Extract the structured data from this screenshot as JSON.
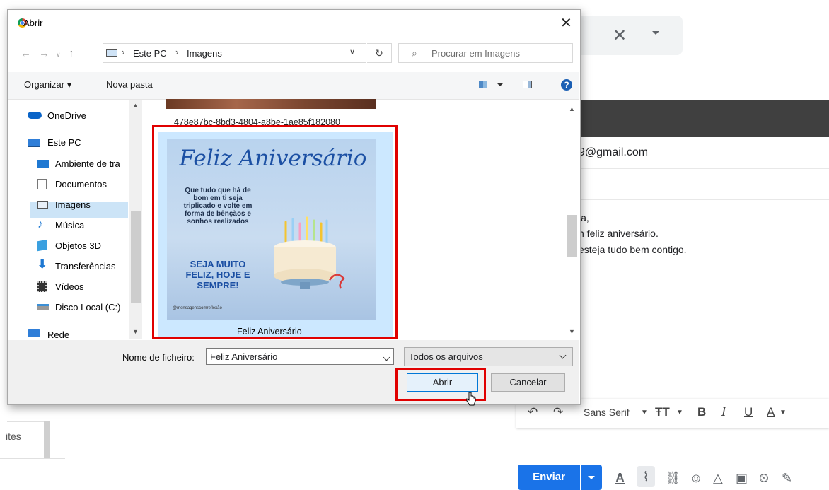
{
  "gmail": {
    "to_address": "9@gmail.com",
    "body_lines": [
      "ia,",
      "n feliz aniversário.",
      "esteja tudo bem contigo."
    ],
    "left_fragment": "ites",
    "format_font": "Sans Serif",
    "send_label": "Enviar"
  },
  "dialog": {
    "title": "Abrir",
    "breadcrumb": [
      "Este PC",
      "Imagens"
    ],
    "search_placeholder": "Procurar em Imagens",
    "toolbar": {
      "organize": "Organizar ▾",
      "new_folder": "Nova pasta",
      "help": "?"
    },
    "nav_items": [
      "OneDrive",
      "Este PC",
      "Ambiente de tra",
      "Documentos",
      "Imagens",
      "Música",
      "Objetos 3D",
      "Transferências",
      "Vídeos",
      "Disco Local (C:)",
      "Rede"
    ],
    "selected_nav": "Imagens",
    "files": [
      {
        "name": "478e87bc-8bd3-4804-a8be-1ae85f182080"
      },
      {
        "name": "Feliz Aniversário",
        "selected": true
      }
    ],
    "card": {
      "title": "Feliz Aniversário",
      "message": "Que tudo que há de bom em ti seja triplicado e volte em forma de bênçãos e sonhos realizados",
      "cta": "SEJA MUITO FELIZ, HOJE E SEMPRE!",
      "handle": "@mensagenscomreflexão"
    },
    "filename_label": "Nome de ficheiro:",
    "filename_value": "Feliz Aniversário",
    "filetype_value": "Todos os arquivos",
    "open_label": "Abrir",
    "cancel_label": "Cancelar"
  },
  "colors": {
    "highlight": "#e00000",
    "gmail_blue": "#1a73e8",
    "selection": "#cce8ff"
  }
}
